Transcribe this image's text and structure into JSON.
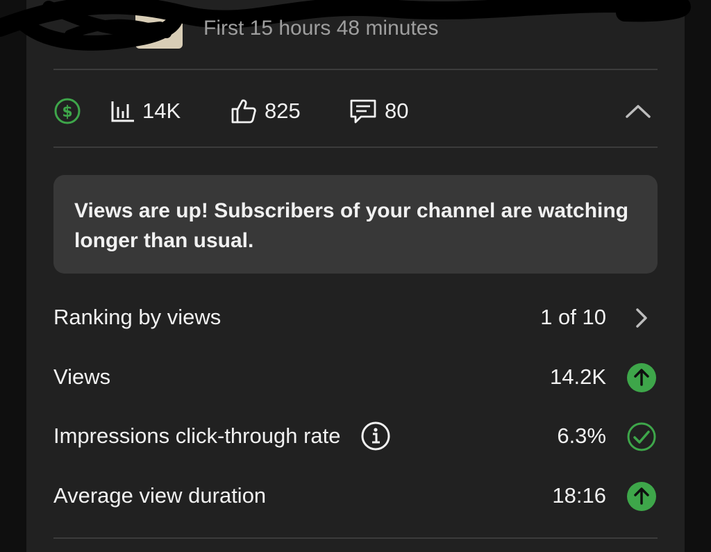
{
  "header": {
    "period_label": "First 15 hours 48 minutes"
  },
  "stats": {
    "views": "14K",
    "likes": "825",
    "comments": "80"
  },
  "insight": {
    "text": "Views are up! Subscribers of your channel are watching longer than usual."
  },
  "metrics": [
    {
      "label": "Ranking by views",
      "value": "1 of 10",
      "trail_icon": "chevron-right-icon"
    },
    {
      "label": "Views",
      "value": "14.2K",
      "trail_icon": "arrow-up-circle-icon"
    },
    {
      "label": "Impressions click-through rate",
      "value": "6.3%",
      "trail_icon": "check-circle-icon",
      "info_icon": "info-icon"
    },
    {
      "label": "Average view duration",
      "value": "18:16",
      "trail_icon": "arrow-up-circle-icon"
    }
  ],
  "colors": {
    "background": "#0f0f0f",
    "panel": "#212121",
    "card": "#383838",
    "accent_green": "#3ea64a",
    "text_primary": "#f1f1f1",
    "text_secondary": "#9e9e9e"
  }
}
